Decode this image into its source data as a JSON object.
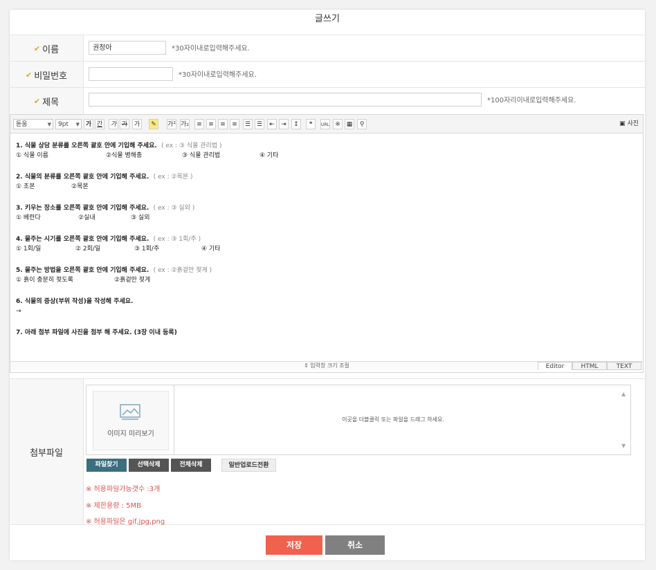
{
  "page_title": "글쓰기",
  "form": {
    "name": {
      "label": "이름",
      "value": "권정아",
      "hint": "*30자이내로입력해주세요."
    },
    "password": {
      "label": "비밀번호",
      "value": "",
      "hint": "*30자이내로입력해주세요."
    },
    "subject": {
      "label": "제목",
      "value": "",
      "hint": "*100자리이내로입력해주세요."
    }
  },
  "toolbar": {
    "font_select": "돋움",
    "size_select": "9pt",
    "photo_label": "사진",
    "buttons": [
      "가",
      "간",
      "가",
      "가",
      "가",
      "가",
      "가",
      "가",
      "가",
      "가",
      "가",
      "가",
      "가",
      "가",
      "가",
      "가",
      "가",
      "가",
      "가",
      "가",
      "가",
      "가"
    ]
  },
  "editor": {
    "questions": [
      {
        "text": "1. 식물 상담 분류를 오른쪽 괄호 안에 기입해 주세요.",
        "example": "( ex : ③ 식물 관리법 )",
        "options": [
          "① 식물 이름",
          "②식물 병해충",
          "③ 식물 관리법",
          "④ 기타"
        ]
      },
      {
        "text": "2. 식물의 분류를 오른쪽 괄호 안에 기입해 주세요.",
        "example": "( ex : ②목본 )",
        "options": [
          "① 초본",
          "②목본"
        ]
      },
      {
        "text": "3. 키우는 장소를 오른쪽 괄호 안에 기입해 주세요.",
        "example": "( ex : ③ 실외 )",
        "options": [
          "① 베란다",
          "②실내",
          "③ 실외"
        ]
      },
      {
        "text": "4. 물주는 시기를 오른쪽 괄호 안에 기입해 주세요.",
        "example": "( ex : ③ 1회/주 )",
        "options": [
          "① 1회/일",
          "② 2회/일",
          "③ 1회/주",
          "④ 기타"
        ]
      },
      {
        "text": "5. 물주는 방법을 오른쪽 괄호 안에 기입해 주세요.",
        "example": "( ex : ②흙겉만 젖게 )",
        "options": [
          "① 흙이 충분히 젖도록",
          "②흙겉만 젖게"
        ]
      },
      {
        "text": "6. 식물의 증상(부위 작성)을 작성해 주세요.",
        "example": "",
        "options": [
          "→"
        ]
      },
      {
        "text": "7. 아래 첨부 파일에 사진을 첨부 해 주세요. (3장 이내 등록)",
        "example": "",
        "options": []
      }
    ],
    "resize_label": "⇕ 입력창 크기 조절",
    "tabs": {
      "editor": "Editor",
      "html": "HTML",
      "text": "TEXT"
    }
  },
  "attach": {
    "label": "첨부파일",
    "preview_label": "이미지 미리보기",
    "drop_message": "이곳을 더블클릭 또는 파일을 드래그 하세요.",
    "buttons": {
      "find": "파일찾기",
      "delete_selected": "선택삭제",
      "delete_all": "전체삭제",
      "switch_mode": "일반업로드전환"
    },
    "rules": [
      "※ 허용파일가능갯수 :3개",
      "※ 제한용량 : 5MB",
      "※ 허용파일은 gif,jpg,png"
    ]
  },
  "actions": {
    "save": "저장",
    "cancel": "취소"
  },
  "colors": {
    "accent": "#f0614e",
    "cancel": "#808080",
    "find_btn": "#3b6f7f",
    "dark_btn": "#555555",
    "rule_text": "#d9534f"
  }
}
